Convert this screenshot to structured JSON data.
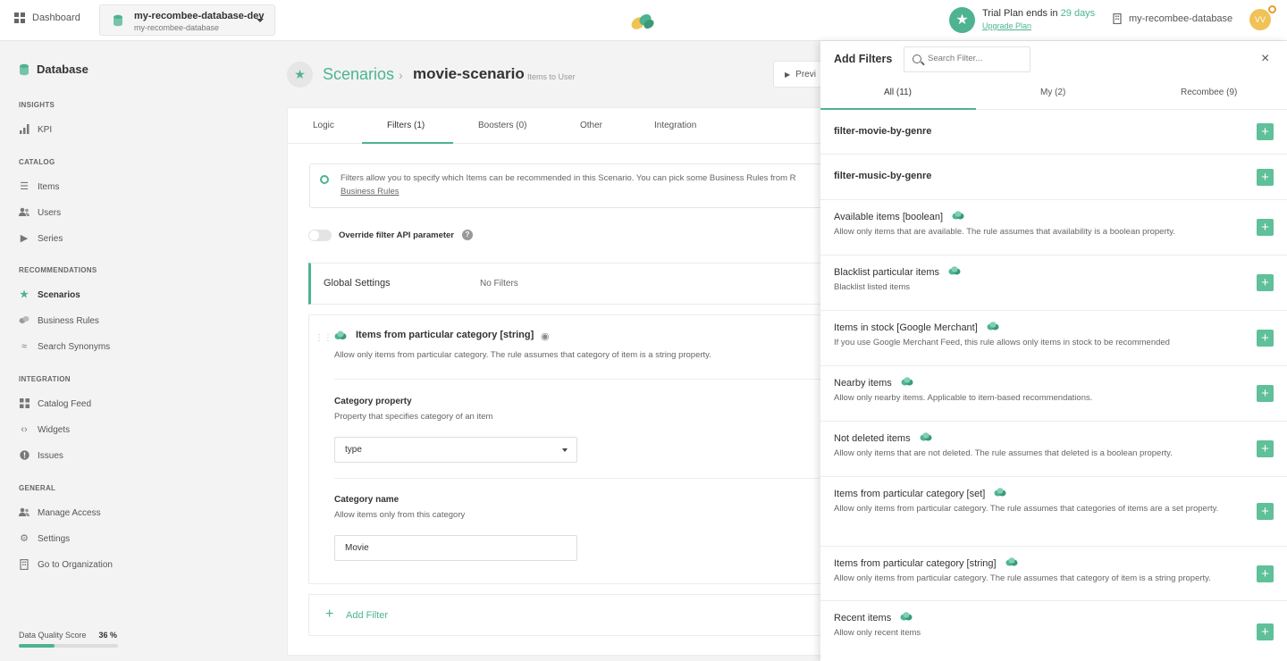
{
  "topbar": {
    "dashboard": "Dashboard",
    "db_name": "my-recombee-database-dev",
    "db_sub": "my-recombee-database",
    "trial_prefix": "Trial Plan",
    "trial_ends": " ends in ",
    "trial_days": "29 days",
    "upgrade": "Upgrade Plan",
    "right_db": "my-recombee-database",
    "avatar": "VV"
  },
  "sidebar": {
    "title": "Database",
    "sections": {
      "insights": "INSIGHTS",
      "catalog": "CATALOG",
      "recommendations": "RECOMMENDATIONS",
      "integration": "INTEGRATION",
      "general": "GENERAL"
    },
    "items": {
      "kpi": "KPI",
      "items": "Items",
      "users": "Users",
      "series": "Series",
      "scenarios": "Scenarios",
      "business_rules": "Business Rules",
      "search_synonyms": "Search Synonyms",
      "catalog_feed": "Catalog Feed",
      "widgets": "Widgets",
      "issues": "Issues",
      "manage_access": "Manage Access",
      "settings": "Settings",
      "go_to_org": "Go to Organization"
    },
    "data_quality_label": "Data Quality Score",
    "data_quality_value": "36 %",
    "data_quality_fraction": 0.36
  },
  "main": {
    "crumb_root": "Scenarios",
    "crumb_sep": "›",
    "crumb_current": "movie-scenario",
    "crumb_sub": "Items to User",
    "preview": "Previ",
    "tabs": [
      "Logic",
      "Filters (1)",
      "Boosters (0)",
      "Other",
      "Integration"
    ],
    "info_line1": "Filters allow you to specify which Items can be recommended in this Scenario. You can pick some Business Rules from R",
    "info_line2": "Business Rules",
    "override_label": "Override filter API parameter",
    "help": "?",
    "global_title": "Global Settings",
    "global_value": "No Filters",
    "filter": {
      "title": "Items from particular category [string]",
      "desc": "Allow only items from particular category. The rule assumes that category of item is a string property.",
      "field1_label": "Category property",
      "field1_help": "Property that specifies category of an item",
      "field1_value": "type",
      "field2_label": "Category name",
      "field2_help": "Allow items only from this category",
      "field2_value": "Movie"
    },
    "add_filter": "Add Filter"
  },
  "panel": {
    "title": "Add Filters",
    "search_placeholder": "Search Filter...",
    "close": "×",
    "tabs": [
      "All (11)",
      "My (2)",
      "Recombee (9)"
    ],
    "rows": [
      {
        "name": "filter-movie-by-genre",
        "desc": "",
        "recombee": false
      },
      {
        "name": "filter-music-by-genre",
        "desc": "",
        "recombee": false
      },
      {
        "name": "Available items [boolean]",
        "desc": "Allow only items that are available. The rule assumes that availability is a boolean property.",
        "recombee": true
      },
      {
        "name": "Blacklist particular items",
        "desc": "Blacklist listed items",
        "recombee": true
      },
      {
        "name": "Items in stock [Google Merchant]",
        "desc": "If you use Google Merchant Feed, this rule allows only items in stock to be recommended",
        "recombee": true
      },
      {
        "name": "Nearby items",
        "desc": "Allow only nearby items. Applicable to item-based recommendations.",
        "recombee": true
      },
      {
        "name": "Not deleted items",
        "desc": "Allow only items that are not deleted. The rule assumes that deleted is a boolean property.",
        "recombee": true
      },
      {
        "name": "Items from particular category [set]",
        "desc": "Allow only items from particular category. The rule assumes that categories of items are a set property.",
        "recombee": true
      },
      {
        "name": "Items from particular category [string]",
        "desc": "Allow only items from particular category. The rule assumes that category of item is a string property.",
        "recombee": true
      },
      {
        "name": "Recent items",
        "desc": "Allow only recent items",
        "recombee": true
      }
    ],
    "add_symbol": "+"
  },
  "colors": {
    "accent": "#4db391"
  }
}
